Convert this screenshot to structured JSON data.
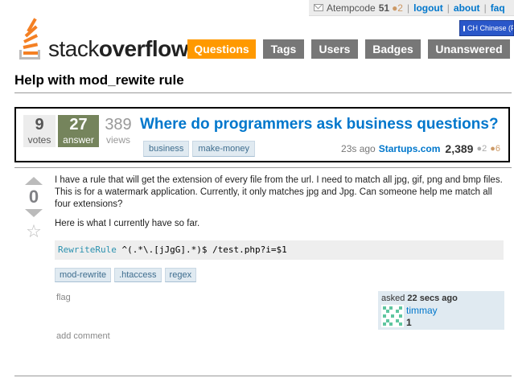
{
  "topbar": {
    "username": "Atempcode",
    "reputation": "51",
    "bronze_badges": "●2",
    "links": [
      "logout",
      "about",
      "faq"
    ]
  },
  "language_widget": {
    "label": "CH Chinese (P"
  },
  "logo": {
    "prefix": "stack",
    "suffix": "overflow"
  },
  "nav": [
    {
      "label": "Questions",
      "active": true
    },
    {
      "label": "Tags",
      "active": false
    },
    {
      "label": "Users",
      "active": false
    },
    {
      "label": "Badges",
      "active": false
    },
    {
      "label": "Unanswered",
      "active": false
    }
  ],
  "page_title": "Help with mod_rewite rule",
  "featured": {
    "votes": "9",
    "votes_label": "votes",
    "answers": "27",
    "answers_label": "answer",
    "views": "389",
    "views_label": "views",
    "title": "Where do programmers ask business questions?",
    "tags": [
      "business",
      "make-money"
    ],
    "time": "23s ago",
    "site": "Startups.com",
    "rep": "2,389",
    "silver": "●2",
    "bronze": "●6"
  },
  "question": {
    "vote_count": "0",
    "paragraphs": [
      "I have a rule that will get the extension of every file from the url. I need to match all jpg, gif, png and bmp files. This is for a watermark application. Currently, it only matches jpg and Jpg. Can someone help me match all four extensions?",
      "Here is what I currently have so far."
    ],
    "code_keyword": "RewriteRule",
    "code_rest": " ^(.*\\.[jJgG].*)$ /test.php?i=$1",
    "tags": [
      "mod-rewrite",
      ".htaccess",
      "regex"
    ],
    "flag_label": "flag",
    "add_comment_label": "add comment",
    "asked_prefix": "asked",
    "asked_time": "22 secs ago",
    "owner_name": "timmay",
    "owner_rep": "1"
  },
  "colors": {
    "accent": "#ff9900",
    "link": "#0077cc",
    "nav": "#777777",
    "answer_box": "#75845c",
    "tag_bg": "#e0eaf1"
  }
}
